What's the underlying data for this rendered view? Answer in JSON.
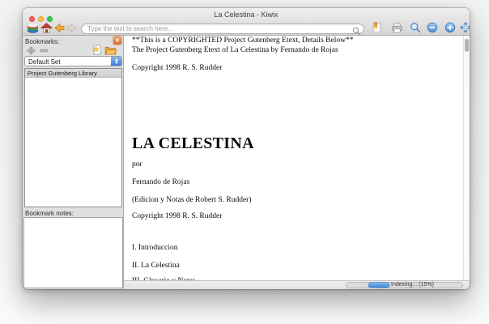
{
  "window": {
    "title": "La Celestina - Kiwix"
  },
  "toolbar": {
    "search_placeholder": "Type the text to search here...",
    "icon_names": [
      "library-icon",
      "home-icon",
      "back-icon",
      "forward-icon",
      "search-icon",
      "bookmark-page-icon",
      "print-icon",
      "find-in-page-icon",
      "zoom-out-icon",
      "zoom-in-icon",
      "fullscreen-icon"
    ]
  },
  "sidebar": {
    "title": "Bookmarks:",
    "set_selector_value": "Default Set",
    "list": [
      "Project Gutenberg Library"
    ],
    "notes_label": "Bookmark notes:",
    "icon_names": [
      "add-bookmark-icon",
      "remove-bookmark-icon",
      "save-set-icon",
      "open-set-icon",
      "close-panel-icon"
    ]
  },
  "article": {
    "copyright_banner": "**This is a COPYRIGHTED Project Gutenberg Etext, Details Below**",
    "etext_line": "The Project Gutenberg Etext of La Celestina by Fernando de Rojas",
    "copyright1": "Copyright 1998 R. S. Rudder",
    "title": "LA CELESTINA",
    "por": "por",
    "author": "Fernando de Rojas",
    "edition_note": "(Edicion y Notas de Robert S. Rudder)",
    "copyright2": "Copyright 1998 R. S. Rudder",
    "toc": [
      "I. Introduccion",
      "II. La Celestina",
      "III. Glosario y Notas"
    ]
  },
  "statusbar": {
    "indexing_label": "Indexing... (15%)",
    "progress_percent": 15
  },
  "colors": {
    "traffic_red": "#fc5b57",
    "traffic_yellow": "#fdbe41",
    "traffic_green": "#35c94a",
    "accent_blue": "#4a8fd4",
    "close_button_orange": "#dd6a26",
    "progress_fill": "#4189d6"
  }
}
